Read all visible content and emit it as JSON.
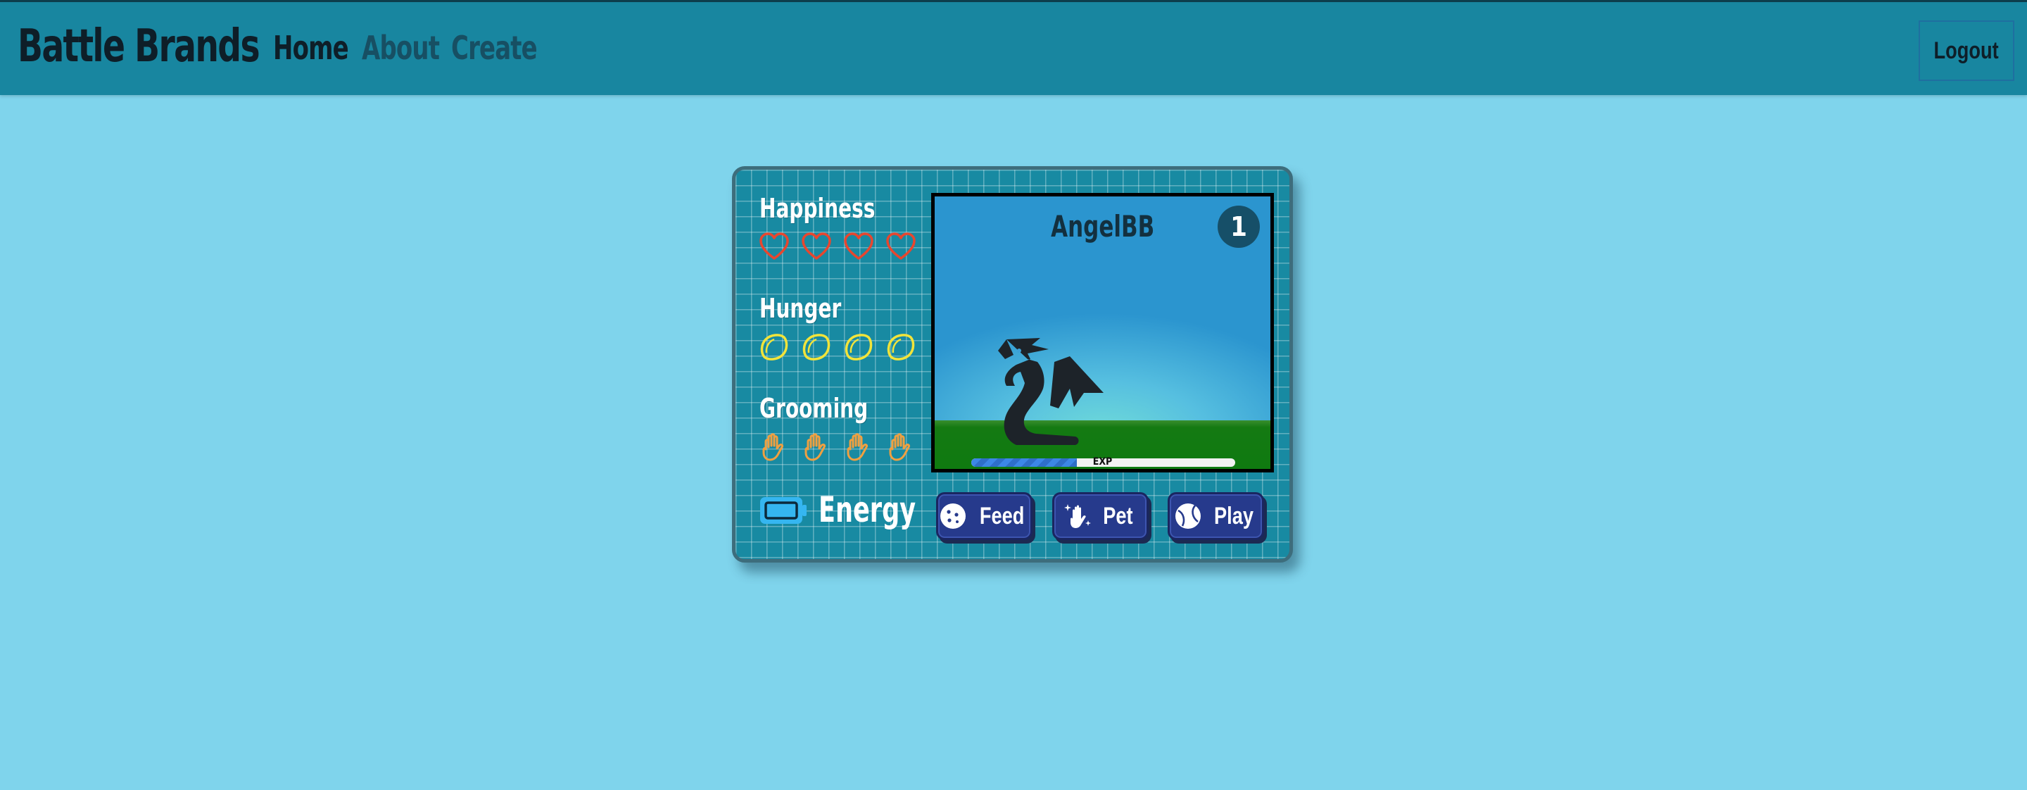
{
  "navbar": {
    "brand": "Battle Brands",
    "links": [
      {
        "label": "Home"
      },
      {
        "label": "About"
      },
      {
        "label": "Create"
      }
    ],
    "logout_label": "Logout"
  },
  "pet_card": {
    "stats": {
      "happiness": {
        "label": "Happiness",
        "level": 4,
        "max": 4,
        "icon": "heart-icon",
        "color": "#e8462e"
      },
      "hunger": {
        "label": "Hunger",
        "level": 4,
        "max": 4,
        "icon": "lemon-icon",
        "color": "#f2e43a"
      },
      "grooming": {
        "label": "Grooming",
        "level": 4,
        "max": 4,
        "icon": "hand-icon",
        "color": "#f0a040"
      }
    },
    "energy": {
      "label": "Energy",
      "icon": "battery-icon",
      "color": "#35b6f0"
    },
    "pet": {
      "name": "AngelBB",
      "level": "1",
      "creature_icon": "dragon-icon",
      "exp_label": "EXP",
      "exp_fraction": 0.4
    },
    "actions": [
      {
        "label": "Feed",
        "icon": "cookie-icon"
      },
      {
        "label": "Pet",
        "icon": "hand-sparkle-icon"
      },
      {
        "label": "Play",
        "icon": "ball-icon"
      }
    ],
    "accent": "#263a8c"
  }
}
